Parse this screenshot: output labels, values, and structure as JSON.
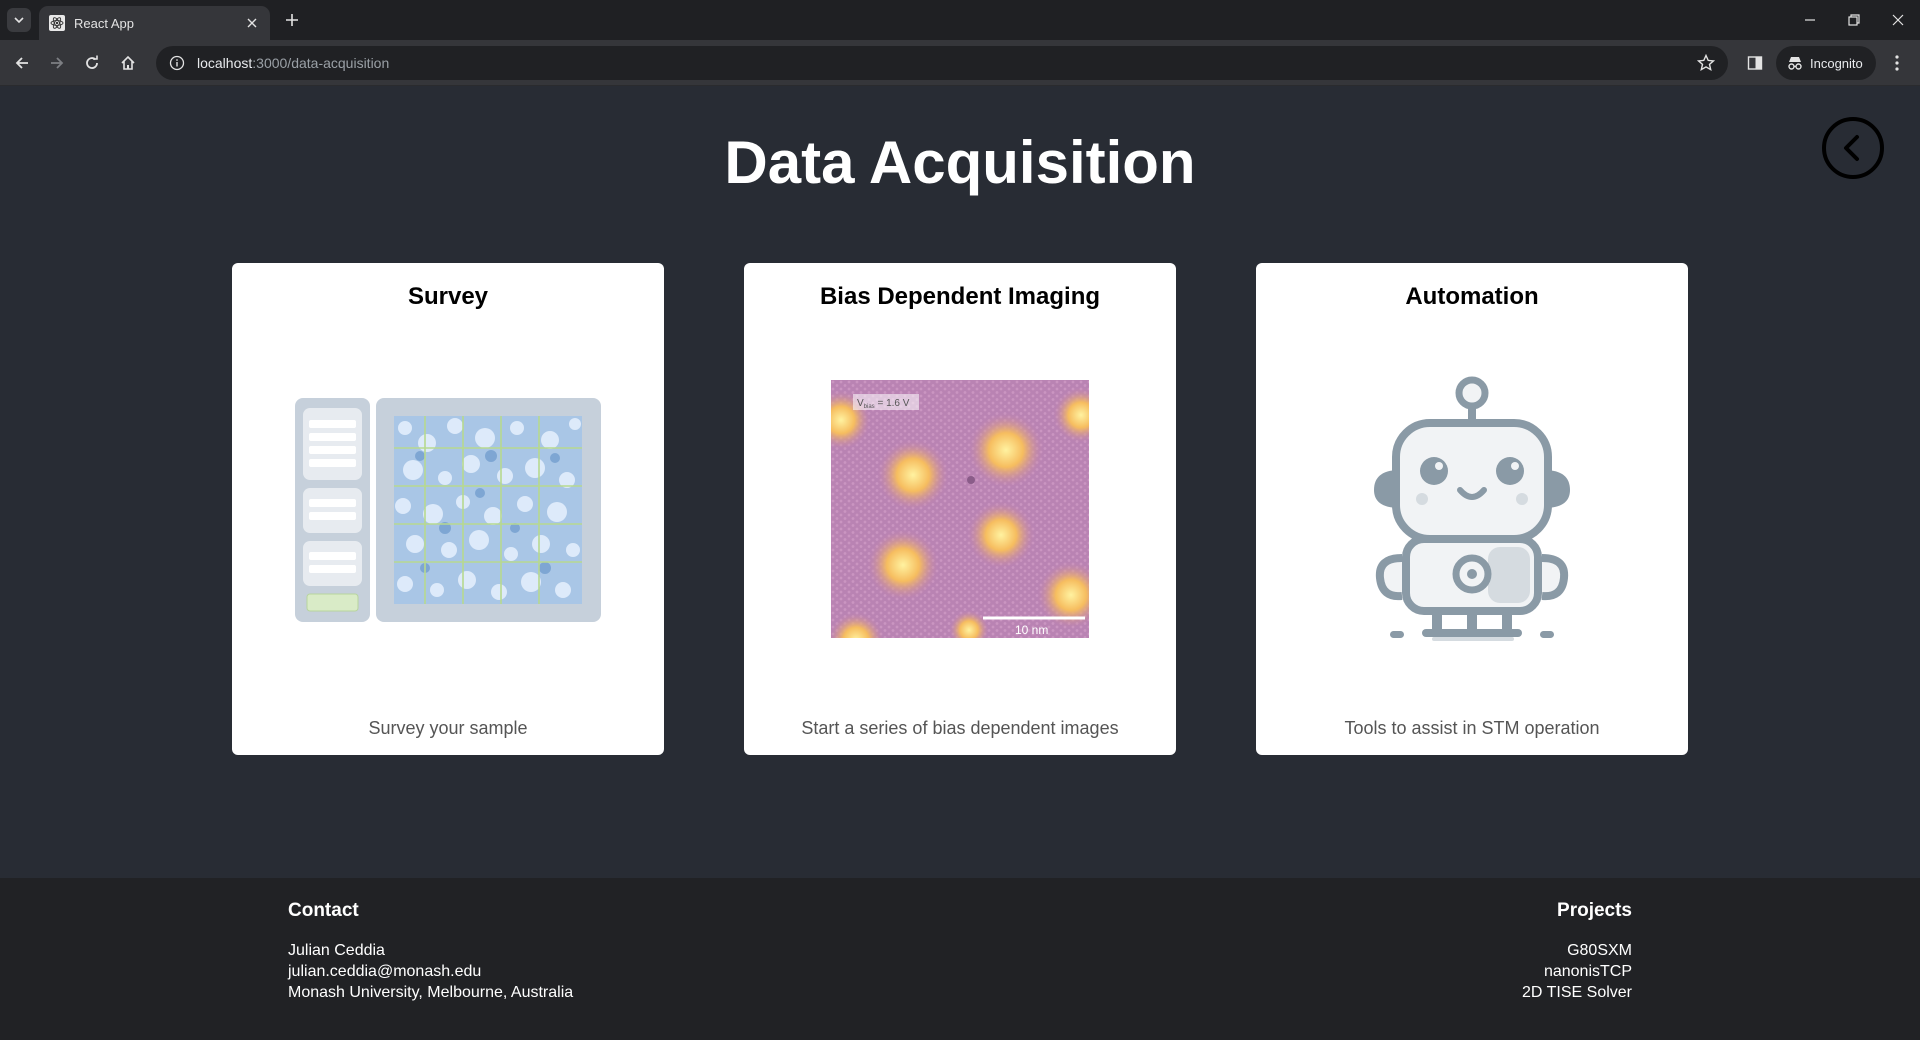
{
  "browser": {
    "tab_title": "React App",
    "url_host": "localhost",
    "url_rest": ":3000/data-acquisition",
    "incognito_label": "Incognito"
  },
  "page": {
    "title": "Data Acquisition"
  },
  "cards": [
    {
      "title": "Survey",
      "description": "Survey your sample"
    },
    {
      "title": "Bias Dependent Imaging",
      "description": "Start a series of bias dependent images",
      "image_label": "V",
      "image_label_sub": "bias",
      "image_label_value": " = 1.6 V",
      "scale_label": "10 nm"
    },
    {
      "title": "Automation",
      "description": "Tools to assist in STM operation"
    }
  ],
  "footer": {
    "contact": {
      "heading": "Contact",
      "lines": [
        "Julian Ceddia",
        "julian.ceddia@monash.edu",
        "Monash University, Melbourne, Australia"
      ]
    },
    "projects": {
      "heading": "Projects",
      "items": [
        "G80SXM",
        "nanonisTCP",
        "2D TISE Solver"
      ]
    }
  }
}
